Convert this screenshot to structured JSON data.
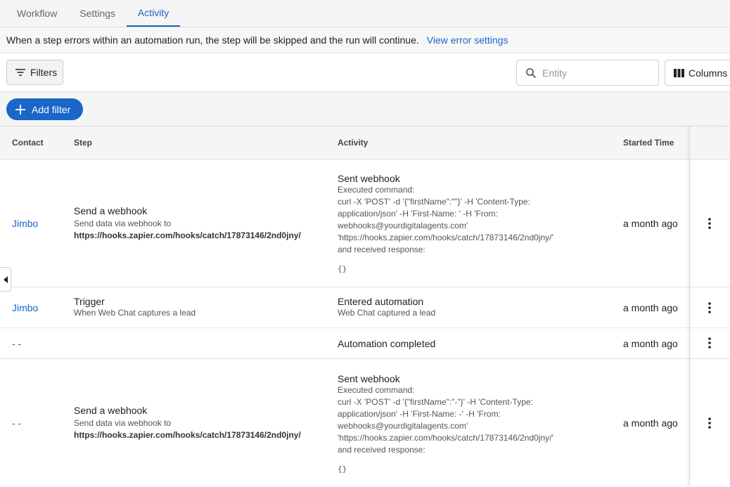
{
  "tabs": [
    {
      "label": "Workflow",
      "active": false
    },
    {
      "label": "Settings",
      "active": false
    },
    {
      "label": "Activity",
      "active": true
    }
  ],
  "notice": {
    "text": "When a step errors within an automation run, the step will be skipped and the run will continue.",
    "link": "View error settings"
  },
  "toolbar": {
    "filters_label": "Filters",
    "entity_placeholder": "Entity",
    "entity_value": "",
    "columns_label": "Columns",
    "add_filter_label": "Add filter"
  },
  "table": {
    "headers": {
      "contact": "Contact",
      "step": "Step",
      "activity": "Activity",
      "started": "Started Time"
    },
    "rows": [
      {
        "contact": "Jimbo",
        "step_title": "Send a webhook",
        "step_sub": "Send data via webhook to",
        "step_url": "https://hooks.zapier.com/hooks/catch/17873146/2nd0jny/",
        "activity_title": "Sent webhook",
        "activity_detail": "Executed command:\ncurl -X 'POST' -d '{\"firstName\":\"\"}' -H 'Content-Type:\napplication/json' -H 'First-Name: ' -H 'From:\nwebhooks@yourdigitalagents.com'\n'https://hooks.zapier.com/hooks/catch/17873146/2nd0jny/'\nand received response:",
        "activity_code": "{}",
        "time": "a month ago"
      },
      {
        "contact": "Jimbo",
        "step_title": "Trigger",
        "step_sub": "When Web Chat captures a lead",
        "activity_title": "Entered automation",
        "activity_detail": "Web Chat captured a lead",
        "time": "a month ago"
      },
      {
        "contact": "- -",
        "activity_title": "Automation completed",
        "time": "a month ago"
      },
      {
        "contact": "- -",
        "step_title": "Send a webhook",
        "step_sub": "Send data via webhook to",
        "step_url": "https://hooks.zapier.com/hooks/catch/17873146/2nd0jny/",
        "activity_title": "Sent webhook",
        "activity_detail": "Executed command:\ncurl -X 'POST' -d '{\"firstName\":\"-\"}' -H 'Content-Type:\napplication/json' -H 'First-Name: -' -H 'From:\nwebhooks@yourdigitalagents.com'\n'https://hooks.zapier.com/hooks/catch/17873146/2nd0jny/'\nand received response:",
        "activity_code": "{}",
        "time": "a month ago"
      }
    ]
  },
  "colors": {
    "accent": "#1a66c9",
    "background": "#f5f5f5"
  }
}
